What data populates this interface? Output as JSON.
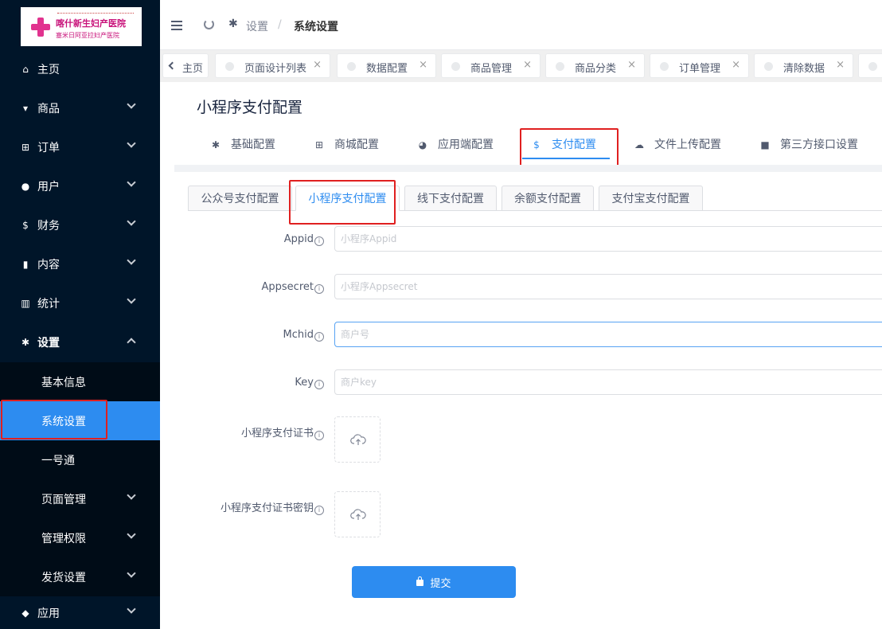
{
  "logo": {
    "name": "喀什新生妇产医院",
    "sub": "塞米日阿亚拉妇产医院"
  },
  "sidebar": {
    "items": [
      {
        "label": "主页",
        "icon": "home-icon"
      },
      {
        "label": "商品",
        "icon": "basket-icon"
      },
      {
        "label": "订单",
        "icon": "cart-icon"
      },
      {
        "label": "用户",
        "icon": "user-icon"
      },
      {
        "label": "财务",
        "icon": "dollar-icon"
      },
      {
        "label": "内容",
        "icon": "book-icon"
      },
      {
        "label": "统计",
        "icon": "bar-chart-icon"
      },
      {
        "label": "设置",
        "icon": "gear-icon"
      },
      {
        "label": "应用",
        "icon": "cube-icon"
      }
    ],
    "submenu": [
      {
        "label": "基本信息"
      },
      {
        "label": "系统设置"
      },
      {
        "label": "一号通"
      },
      {
        "label": "页面管理"
      },
      {
        "label": "管理权限"
      },
      {
        "label": "发货设置"
      }
    ]
  },
  "header": {
    "breadcrumb": [
      "设置",
      "系统设置"
    ],
    "sep": "/"
  },
  "tagsbar": {
    "home": "主页",
    "tags": [
      "页面设计列表",
      "数据配置",
      "商品管理",
      "商品分类",
      "订单管理",
      "清除数据"
    ]
  },
  "page": {
    "title": "小程序支付配置",
    "tabs": [
      {
        "label": "基础配置",
        "icon": "gear-icon"
      },
      {
        "label": "商城配置",
        "icon": "cart-icon"
      },
      {
        "label": "应用端配置",
        "icon": "pie-icon"
      },
      {
        "label": "支付配置",
        "icon": "dollar-icon"
      },
      {
        "label": "文件上传配置",
        "icon": "cloud-upload-icon"
      },
      {
        "label": "第三方接口设置",
        "icon": "briefcase-icon"
      }
    ],
    "subtabs": [
      "公众号支付配置",
      "小程序支付配置",
      "线下支付配置",
      "余额支付配置",
      "支付宝支付配置"
    ]
  },
  "form": {
    "fields": [
      {
        "label": "Appid",
        "placeholder": "小程序Appid"
      },
      {
        "label": "Appsecret",
        "placeholder": "小程序Appsecret"
      },
      {
        "label": "Mchid",
        "placeholder": "商户号"
      },
      {
        "label": "Key",
        "placeholder": "商户key"
      }
    ],
    "uploads": [
      {
        "label": "小程序支付证书"
      },
      {
        "label": "小程序支付证书密钥"
      }
    ],
    "submit": "提交"
  },
  "colors": {
    "accent": "#2d8cf0",
    "sidebar": "#001529",
    "highlight": "#e02020"
  }
}
